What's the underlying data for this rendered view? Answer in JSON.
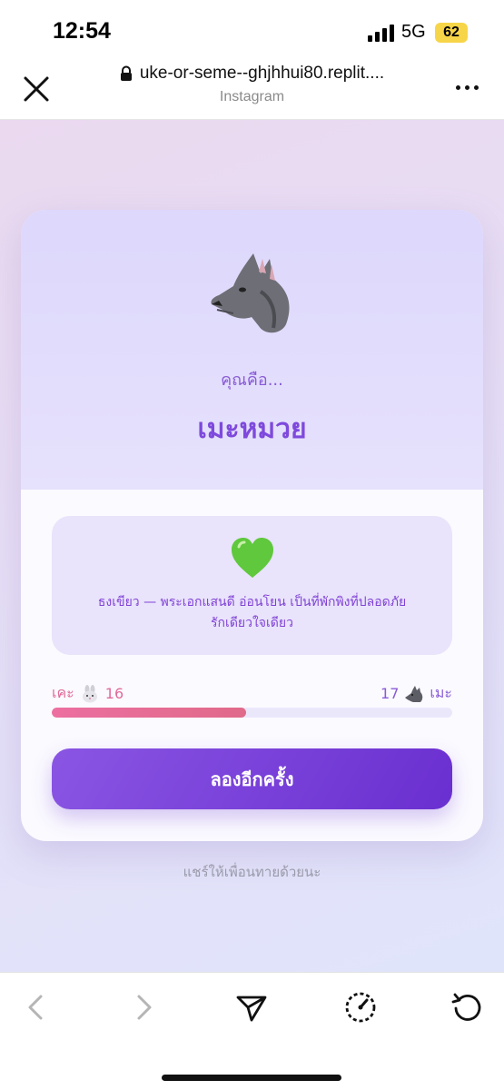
{
  "status_bar": {
    "time": "12:54",
    "network": "5G",
    "battery": "62",
    "battery_color": "#f7d548"
  },
  "browser": {
    "url": "uke-or-seme--ghjhhui80.replit....",
    "source": "Instagram",
    "close_icon": "close-icon",
    "more_icon": "more-icon"
  },
  "result_card": {
    "you_are": "คุณคือ...",
    "result_title": "เมะหมวย",
    "result_icon": "wolf-icon",
    "description_icon": "green-heart-icon",
    "description_line1": "ธงเขียว — พระเอกแสนดี อ่อนโยน เป็นที่พักพิงที่ปลอดภัย",
    "description_line2": "รักเดียวใจเดียว",
    "score": {
      "uke_label": "เคะ",
      "uke_icon": "rabbit-icon",
      "uke_value": "16",
      "seme_label": "เมะ",
      "seme_icon": "wolf-icon",
      "seme_value": "17",
      "uke_bar_fraction": 0.485
    },
    "retry_label": "ลองอีกครั้ง"
  },
  "share_hint": "แชร์ให้เพื่อนทายด้วยนะ",
  "toolbar": {
    "icons": [
      "back-icon",
      "forward-icon",
      "share-icon",
      "speed-icon",
      "refresh-icon"
    ]
  },
  "colors": {
    "accent_purple": "#7e49dc",
    "button_purple": "#6a2fd0",
    "uke_pink": "#e06a9a"
  }
}
